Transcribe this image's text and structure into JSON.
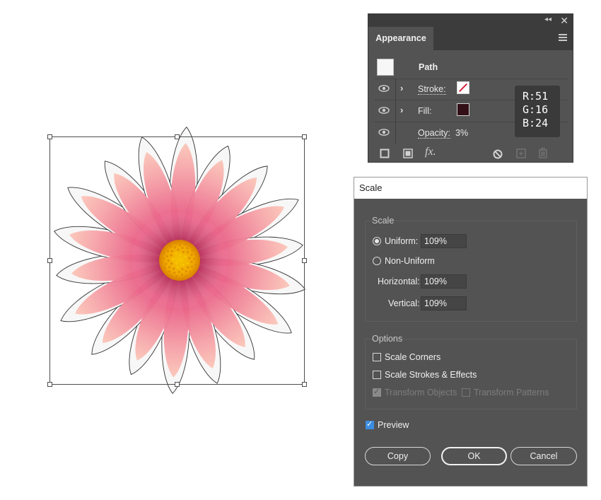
{
  "appearance": {
    "tab_label": "Appearance",
    "path_label": "Path",
    "stroke_label": "Stroke:",
    "fill_label": "Fill:",
    "opacity_label": "Opacity:",
    "opacity_value": "3%",
    "stroke_color": "#ffffff",
    "stroke_slash_color": "#d0102a",
    "fill_color": "#331018",
    "tooltip": {
      "r": "R:51",
      "g": "G:16",
      "b": "B:24"
    },
    "icons": [
      "collapse-arrows-icon",
      "close-icon",
      "panel-menu-icon",
      "eye-icon",
      "chevron-right-icon",
      "add-stroke-icon",
      "add-fill-icon",
      "fx-icon",
      "clear-appearance-icon",
      "duplicate-item-icon",
      "trash-icon"
    ]
  },
  "scale_dialog": {
    "title": "Scale",
    "scale_group_title": "Scale",
    "uniform_label": "Uniform:",
    "uniform_value": "109%",
    "non_uniform_label": "Non-Uniform",
    "horizontal_label": "Horizontal:",
    "horizontal_value": "109%",
    "vertical_label": "Vertical:",
    "vertical_value": "109%",
    "options_group_title": "Options",
    "scale_corners_label": "Scale Corners",
    "scale_strokes_label": "Scale Strokes & Effects",
    "transform_objects_label": "Transform Objects",
    "transform_patterns_label": "Transform Patterns",
    "preview_label": "Preview",
    "copy_label": "Copy",
    "ok_label": "OK",
    "cancel_label": "Cancel",
    "selected_scale_mode": "Uniform",
    "preview_checked": true,
    "scale_corners_checked": false,
    "scale_strokes_checked": false,
    "transform_objects_checked": true,
    "transform_patterns_checked": false
  },
  "artwork": {
    "description_name": "pink-daisy-artwork",
    "petal_color": "#f07a94",
    "petal_light_color": "#f9c2b8",
    "center_color": "#f2b100"
  }
}
